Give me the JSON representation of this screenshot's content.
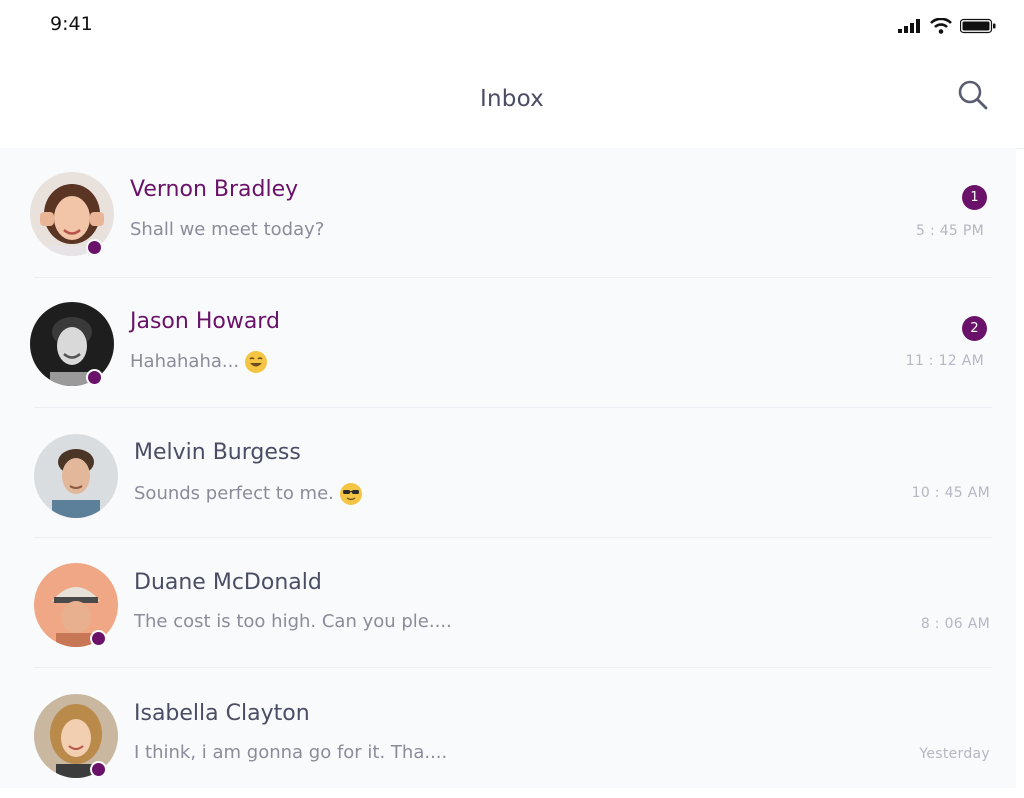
{
  "status_bar": {
    "time": "9:41"
  },
  "header": {
    "title": "Inbox"
  },
  "conversations": [
    {
      "name": "Vernon Bradley",
      "preview": "Shall we meet today?",
      "time": "5 : 45 PM",
      "unread_count": "1",
      "online": true,
      "emoji": ""
    },
    {
      "name": "Jason Howard",
      "preview": "Hahahaha...",
      "time": "11 : 12 AM",
      "unread_count": "2",
      "online": true,
      "emoji": "laughing-emoji"
    },
    {
      "name": "Melvin Burgess",
      "preview": "Sounds perfect to me.",
      "time": "10 : 45 AM",
      "unread_count": "",
      "online": false,
      "emoji": "sunglasses-emoji"
    },
    {
      "name": "Duane McDonald",
      "preview": "The cost is too high. Can you ple....",
      "time": "8 : 06 AM",
      "unread_count": "",
      "online": true,
      "emoji": ""
    },
    {
      "name": "Isabella Clayton",
      "preview": "I think, i am gonna go for it. Tha....",
      "time": "Yesterday",
      "unread_count": "",
      "online": true,
      "emoji": ""
    }
  ],
  "colors": {
    "accent": "#6a1269",
    "title": "#4a4d64",
    "muted": "#8a8c99",
    "time": "#b5b7c2"
  }
}
